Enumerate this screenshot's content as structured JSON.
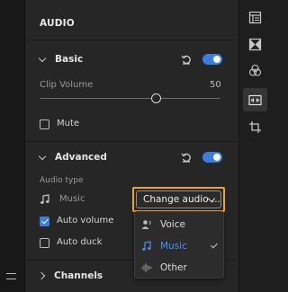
{
  "panel": {
    "title": "AUDIO"
  },
  "basic": {
    "label": "Basic",
    "enabled": true,
    "clip_volume_label": "Clip Volume",
    "clip_volume_value": "50",
    "mute_label": "Mute",
    "mute_checked": false
  },
  "advanced": {
    "label": "Advanced",
    "enabled": true,
    "audio_type_label": "Audio type",
    "current_type": "Music",
    "change_button_label": "Change audio ...",
    "auto_volume_label": "Auto volume",
    "auto_volume_checked": true,
    "auto_duck_label": "Auto duck",
    "auto_duck_checked": false
  },
  "dropdown": {
    "options": [
      {
        "label": "Voice",
        "icon": "voice-icon",
        "selected": false
      },
      {
        "label": "Music",
        "icon": "music-note-icon",
        "selected": true
      },
      {
        "label": "Other",
        "icon": "waveform-icon",
        "selected": false
      }
    ]
  },
  "channels": {
    "label": "Channels"
  },
  "right_rail": {
    "icons": [
      "properties-icon",
      "transition-icon",
      "color-icon",
      "audio-panel-icon",
      "crop-icon"
    ],
    "active": "audio-panel-icon"
  },
  "colors": {
    "accent": "#3a7ee0",
    "highlight_outline": "#f0a326",
    "panel_bg": "#262626"
  }
}
